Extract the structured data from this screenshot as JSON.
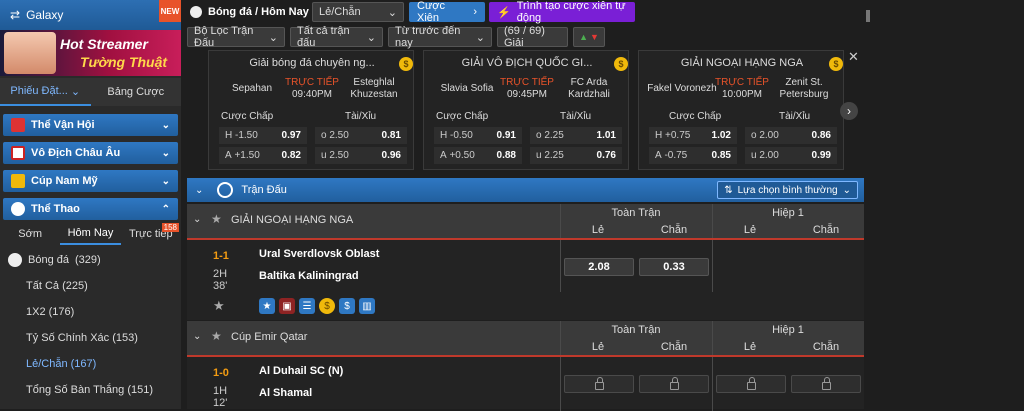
{
  "sidebar": {
    "brand": "Galaxy",
    "new_badge": "NEW",
    "banner": {
      "line1": "Hot Streamer",
      "line2": "Tường Thuật"
    },
    "tabs": [
      "Phiếu Đặt...",
      "Bảng Cược"
    ],
    "menu": [
      {
        "label": "Thể Vận Hội",
        "icon": "torch-icon",
        "color": "#2f78c3"
      },
      {
        "label": "Vô Địch Châu Âu",
        "icon": "euro-flag-icon",
        "color": "#2f78c3"
      },
      {
        "label": "Cúp Nam Mỹ",
        "icon": "trophy-icon",
        "color": "#2f78c3"
      },
      {
        "label": "Thể Thao",
        "icon": "soccer-ball-icon",
        "color": "#2f78c3"
      }
    ],
    "subtabs": [
      "Sớm",
      "Hôm Nay",
      "Trực tiếp"
    ],
    "live_count": "158",
    "sport": "Bóng đá",
    "sport_count": "(329)",
    "bet_types": [
      {
        "label": "Tất Cả (225)"
      },
      {
        "label": "1X2 (176)"
      },
      {
        "label": "Tỷ Số Chính Xác (153)"
      },
      {
        "label": "Lẻ/Chẵn (167)"
      },
      {
        "label": "Tổng Số Bàn Thắng (151)"
      }
    ]
  },
  "topbar": {
    "breadcrumb": "Bóng đá / Hôm Nay",
    "market_select": "Lẻ/Chẵn",
    "parlay_button": "Cược Xiên",
    "builder_button": "Trình tạo cược xiên tự động"
  },
  "filters": {
    "league_filter": "Bộ Lọc Trận Đấu",
    "all_matches": "Tất cả trận đấu",
    "time_filter": "Từ trước đến nay",
    "count": "(69 / 69) Giải"
  },
  "cards": [
    {
      "league": "Giải bóng đá chuyên ng...",
      "home": "Sepahan",
      "away": "Esteghlal Khuzestan",
      "status": "TRỰC TIẾP",
      "time": "09:40PM",
      "hdr_h": "Cược Chấp",
      "hdr_ou": "Tài/Xỉu",
      "rows": [
        [
          "H",
          "-1.50",
          "0.97",
          "o",
          "2.50",
          "0.81"
        ],
        [
          "A",
          "+1.50",
          "0.82",
          "u",
          "2.50",
          "0.96"
        ]
      ]
    },
    {
      "league": "GIẢI VÔ ĐỊCH QUỐC GI...",
      "home": "Slavia Sofia",
      "away": "FC Arda Kardzhali",
      "status": "TRỰC TIẾP",
      "time": "09:45PM",
      "hdr_h": "Cược Chấp",
      "hdr_ou": "Tài/Xỉu",
      "rows": [
        [
          "H",
          "-0.50",
          "0.91",
          "o",
          "2.25",
          "1.01"
        ],
        [
          "A",
          "+0.50",
          "0.88",
          "u",
          "2.25",
          "0.76"
        ]
      ]
    },
    {
      "league": "GIẢI NGOẠI HẠNG NGA",
      "home": "Fakel Voronezh",
      "away": "Zenit St. Petersburg",
      "status": "TRỰC TIẾP",
      "time": "10:00PM",
      "hdr_h": "Cược Chấp",
      "hdr_ou": "Tài/Xỉu",
      "rows": [
        [
          "H",
          "+0.75",
          "1.02",
          "o",
          "2.00",
          "0.86"
        ],
        [
          "A",
          "-0.75",
          "0.85",
          "u",
          "2.00",
          "0.99"
        ]
      ]
    }
  ],
  "table": {
    "title": "Trận Đấu",
    "sort_select": "Lựa chọn bình thường",
    "col_full": "Toàn Trận",
    "col_half": "Hiệp 1",
    "col_odd": "Lẻ",
    "col_even": "Chẵn",
    "sections": [
      {
        "league": "GIẢI NGOẠI HẠNG NGA",
        "score": "1-1",
        "period": "2H",
        "minute": "38'",
        "home": "Ural Sverdlovsk Oblast",
        "away": "Baltika Kaliningrad",
        "odd": "2.08",
        "even": "0.33"
      },
      {
        "league": "Cúp Emir Qatar",
        "score": "1-0",
        "period": "1H",
        "minute": "12'",
        "home": "Al Duhail SC (N)",
        "away": "Al Shamal"
      }
    ]
  }
}
